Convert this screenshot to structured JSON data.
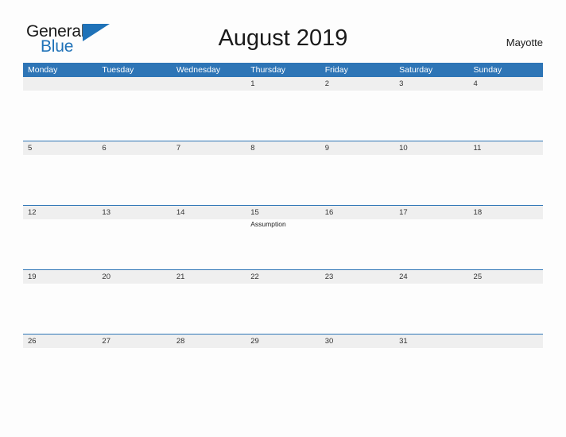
{
  "brand": {
    "name_part1": "General",
    "name_part2": "Blue",
    "flag_icon": "triangle-flag-icon",
    "color_primary": "#1f72b8",
    "color_text": "#1a1a1a"
  },
  "header": {
    "title": "August 2019",
    "location": "Mayotte"
  },
  "calendar": {
    "header_color": "#2e75b6",
    "band_color": "#efefef",
    "day_names": [
      "Monday",
      "Tuesday",
      "Wednesday",
      "Thursday",
      "Friday",
      "Saturday",
      "Sunday"
    ],
    "weeks": [
      {
        "days": [
          {
            "date": "",
            "events": []
          },
          {
            "date": "",
            "events": []
          },
          {
            "date": "",
            "events": []
          },
          {
            "date": "1",
            "events": []
          },
          {
            "date": "2",
            "events": []
          },
          {
            "date": "3",
            "events": []
          },
          {
            "date": "4",
            "events": []
          }
        ]
      },
      {
        "days": [
          {
            "date": "5",
            "events": []
          },
          {
            "date": "6",
            "events": []
          },
          {
            "date": "7",
            "events": []
          },
          {
            "date": "8",
            "events": []
          },
          {
            "date": "9",
            "events": []
          },
          {
            "date": "10",
            "events": []
          },
          {
            "date": "11",
            "events": []
          }
        ]
      },
      {
        "days": [
          {
            "date": "12",
            "events": []
          },
          {
            "date": "13",
            "events": []
          },
          {
            "date": "14",
            "events": []
          },
          {
            "date": "15",
            "events": [
              "Assumption"
            ]
          },
          {
            "date": "16",
            "events": []
          },
          {
            "date": "17",
            "events": []
          },
          {
            "date": "18",
            "events": []
          }
        ]
      },
      {
        "days": [
          {
            "date": "19",
            "events": []
          },
          {
            "date": "20",
            "events": []
          },
          {
            "date": "21",
            "events": []
          },
          {
            "date": "22",
            "events": []
          },
          {
            "date": "23",
            "events": []
          },
          {
            "date": "24",
            "events": []
          },
          {
            "date": "25",
            "events": []
          }
        ]
      },
      {
        "days": [
          {
            "date": "26",
            "events": []
          },
          {
            "date": "27",
            "events": []
          },
          {
            "date": "28",
            "events": []
          },
          {
            "date": "29",
            "events": []
          },
          {
            "date": "30",
            "events": []
          },
          {
            "date": "31",
            "events": []
          },
          {
            "date": "",
            "events": []
          }
        ]
      }
    ]
  }
}
